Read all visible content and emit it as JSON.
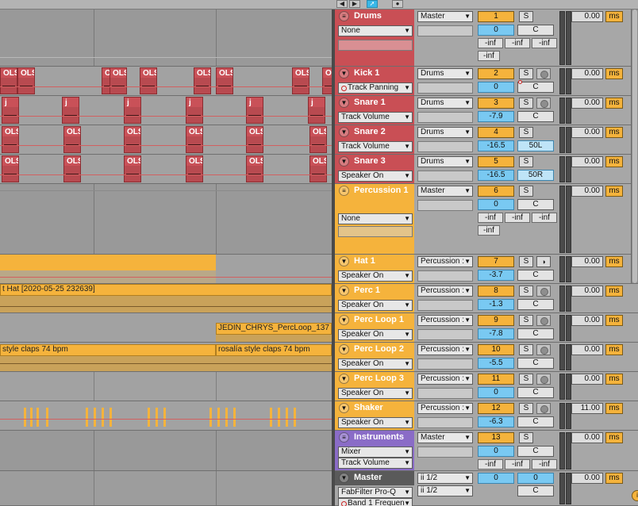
{
  "colors": {
    "red_track": "#c94f55",
    "orange_track": "#f5b33c",
    "purple_track": "#8a6cc7",
    "master_track": "#5a5a5a",
    "volume_blue": "#79c9f2"
  },
  "arrangement": {
    "clips": {
      "kick": "OLS",
      "snare_marker": "j",
      "hat_clip": "t Hat [2020-05-25 232639]",
      "perc_loop_1_clip": "JEDIN_CHRYS_PercLoop_137",
      "perc_loop_2_clip_a": "style claps 74 bpm",
      "perc_loop_2_clip_b": "rosalía style claps 74 bpm"
    }
  },
  "mixer": {
    "ms_label": "ms",
    "solo_label": "S",
    "inf_label": "-inf",
    "tracks": [
      {
        "name": "Drums",
        "routing": "Master",
        "device": "None",
        "number": "1",
        "volume": "0",
        "pan": "C",
        "delay": "0.00"
      },
      {
        "name": "Kick 1",
        "routing": "Drums",
        "device": "Track Panning",
        "number": "2",
        "volume": "0",
        "pan": "C",
        "delay": "0.00"
      },
      {
        "name": "Snare 1",
        "routing": "Drums",
        "device": "Track Volume",
        "number": "3",
        "volume": "-7.9",
        "pan": "C",
        "delay": "0.00"
      },
      {
        "name": "Snare 2",
        "routing": "Drums",
        "device": "Track Volume",
        "number": "4",
        "volume": "-16.5",
        "pan": "50L",
        "delay": "0.00"
      },
      {
        "name": "Snare 3",
        "routing": "Drums",
        "device": "Speaker On",
        "number": "5",
        "volume": "-16.5",
        "pan": "50R",
        "delay": "0.00"
      },
      {
        "name": "Percussion 1",
        "routing": "Master",
        "device": "None",
        "number": "6",
        "volume": "0",
        "pan": "C",
        "delay": "0.00"
      },
      {
        "name": "Hat 1",
        "routing": "Percussion :",
        "device": "Speaker On",
        "number": "7",
        "volume": "-3.7",
        "pan": "C",
        "delay": "0.00"
      },
      {
        "name": "Perc 1",
        "routing": "Percussion :",
        "device": "Speaker On",
        "number": "8",
        "volume": "-1.3",
        "pan": "C",
        "delay": "0.00"
      },
      {
        "name": "Perc Loop 1",
        "routing": "Percussion :",
        "device": "Speaker On",
        "number": "9",
        "volume": "-7.8",
        "pan": "C",
        "delay": "0.00"
      },
      {
        "name": "Perc Loop 2",
        "routing": "Percussion :",
        "device": "Speaker On",
        "number": "10",
        "volume": "-5.5",
        "pan": "C",
        "delay": "0.00"
      },
      {
        "name": "Perc Loop 3",
        "routing": "Percussion :",
        "device": "Speaker On",
        "number": "11",
        "volume": "0",
        "pan": "C",
        "delay": "0.00"
      },
      {
        "name": "Shaker",
        "routing": "Percussion :",
        "device": "Speaker On",
        "number": "12",
        "volume": "-6.3",
        "pan": "C",
        "delay": "11.00"
      },
      {
        "name": "Instruments",
        "routing": "Master",
        "device": "Mixer",
        "device2": "Track Volume",
        "number": "13",
        "volume": "0",
        "pan": "C",
        "delay": "0.00"
      },
      {
        "name": "Master",
        "routing": "ii 1/2",
        "routing2": "ii 1/2",
        "device": "FabFilter Pro-Q",
        "device2": "Band 1 Frequen",
        "volume": "0",
        "volume2": "0",
        "pan": "C",
        "delay": "0.00"
      }
    ]
  }
}
